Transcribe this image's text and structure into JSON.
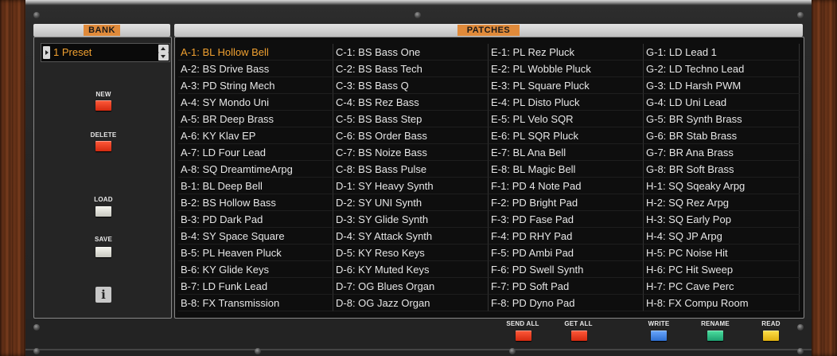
{
  "bank": {
    "header": "BANK",
    "preset_value": "1 Preset",
    "buttons": {
      "new": "NEW",
      "delete": "DELETE",
      "load": "LOAD",
      "save": "SAVE"
    }
  },
  "patches": {
    "header": "PATCHES",
    "selected": "A-1: BL Hollow Bell",
    "columns": [
      [
        "A-1: BL Hollow Bell",
        "A-2: BS Drive Bass",
        "A-3: PD String Mech",
        "A-4: SY Mondo Uni",
        "A-5: BR Deep Brass",
        "A-6: KY Klav EP",
        "A-7: LD Four Lead",
        "A-8: SQ DreamtimeArpg",
        "B-1: BL Deep Bell",
        "B-2: BS Hollow Bass",
        "B-3: PD Dark Pad",
        "B-4: SY Space Square",
        "B-5: PL Heaven Pluck",
        "B-6: KY Glide Keys",
        "B-7: LD Funk Lead",
        "B-8: FX Transmission"
      ],
      [
        "C-1: BS Bass One",
        "C-2: BS Bass Tech",
        "C-3: BS Bass Q",
        "C-4: BS Rez Bass",
        "C-5: BS Bass Step",
        "C-6: BS Order Bass",
        "C-7: BS Noize Bass",
        "C-8: BS Bass Pulse",
        "D-1: SY Heavy Synth",
        "D-2: SY UNI Synth",
        "D-3: SY Glide Synth",
        "D-4: SY Attack Synth",
        "D-5: KY Reso Keys",
        "D-6: KY Muted Keys",
        "D-7: OG Blues Organ",
        "D-8: OG Jazz Organ"
      ],
      [
        "E-1: PL Rez Pluck",
        "E-2: PL Wobble Pluck",
        "E-3: PL Square Pluck",
        "E-4: PL Disto Pluck",
        "E-5: PL Velo SQR",
        "E-6: PL SQR Pluck",
        "E-7: BL Ana Bell",
        "E-8: BL Magic Bell",
        "F-1: PD 4 Note Pad",
        "F-2: PD Bright Pad",
        "F-3: PD Fase Pad",
        "F-4: PD RHY Pad",
        "F-5: PD Ambi Pad",
        "F-6: PD Swell Synth",
        "F-7: PD Soft Pad",
        "F-8: PD Dyno Pad"
      ],
      [
        "G-1: LD Lead 1",
        "G-2: LD Techno Lead",
        "G-3: LD Harsh PWM",
        "G-4: LD Uni Lead",
        "G-5: BR Synth Brass",
        "G-6: BR Stab Brass",
        "G-7: BR Ana Brass",
        "G-8: BR Soft Brass",
        "H-1: SQ Sqeaky Arpg",
        "H-2: SQ Rez Arpg",
        "H-3: SQ Early Pop",
        "H-4: SQ JP Arpg",
        "H-5: PC Noise Hit",
        "H-6: PC Hit Sweep",
        "H-7: PC Cave Perc",
        "H-8: FX Compu Room"
      ]
    ]
  },
  "footer": {
    "send_all": "SEND ALL",
    "get_all": "GET ALL",
    "write": "WRITE",
    "rename": "RENAME",
    "read": "READ"
  },
  "colors": {
    "accent": "#f0a030",
    "section_tag": "#e08a3a"
  },
  "icons": {
    "info": "i"
  }
}
